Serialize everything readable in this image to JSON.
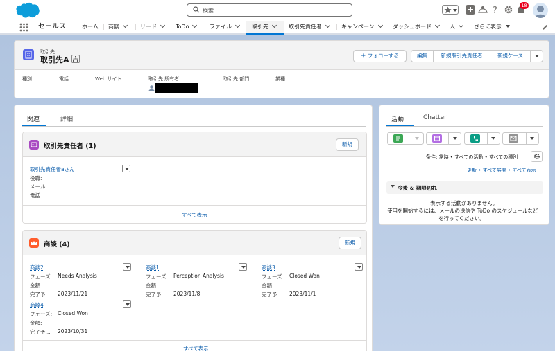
{
  "header": {
    "search_placeholder": "検索...",
    "notification_count": "18"
  },
  "nav": {
    "app_name": "セールス",
    "items": [
      {
        "label": "ホーム"
      },
      {
        "label": "商談"
      },
      {
        "label": "リード"
      },
      {
        "label": "ToDo"
      },
      {
        "label": "ファイル"
      },
      {
        "label": "取引先"
      },
      {
        "label": "取引先責任者"
      },
      {
        "label": "キャンペーン"
      },
      {
        "label": "ダッシュボード"
      },
      {
        "label": "人"
      },
      {
        "label": "さらに表示"
      }
    ]
  },
  "record": {
    "object_label": "取引先",
    "name": "取引先A",
    "actions": {
      "follow": "＋ フォローする",
      "edit": "編集",
      "new_contact": "新規取引先責任者",
      "new_case": "新規ケース"
    },
    "fields": [
      "種別",
      "電話",
      "Web サイト",
      "取引先 所有者",
      "取引先 部門",
      "業種"
    ]
  },
  "tabs": {
    "related": "関連",
    "detail": "詳細"
  },
  "contacts_card": {
    "title": "取引先責任者 (1)",
    "new_button": "新規",
    "contact_name": "取引先責任者aさん",
    "label_title": "役職:",
    "label_email": "メール:",
    "label_phone": "電話:",
    "view_all": "すべて表示"
  },
  "opps_card": {
    "title": "商談 (4)",
    "new_button": "新規",
    "phase_label": "フェーズ:",
    "amount_label": "金額:",
    "close_label": "完了予...",
    "items": [
      {
        "name": "商談2",
        "phase": "Needs Analysis",
        "close": "2023/11/21"
      },
      {
        "name": "商談1",
        "phase": "Perception Analysis",
        "close": "2023/11/8"
      },
      {
        "name": "商談3",
        "phase": "Closed Won",
        "close": "2023/11/1"
      },
      {
        "name": "商談4",
        "phase": "Closed Won",
        "close": "2023/10/31"
      }
    ],
    "view_all": "すべて表示"
  },
  "activity": {
    "tab_activity": "活動",
    "tab_chatter": "Chatter",
    "filter_text": "条件: 常時 • すべての活動 • すべての種別",
    "links": {
      "refresh": "更新",
      "sep1": " • ",
      "expand_all": "すべて展開",
      "sep2": " • ",
      "show_all": "すべて表示"
    },
    "section_title": "今後 & 期限切れ",
    "empty_line1": "表示する活動がありません。",
    "empty_line2": "使用を開始するには、メールの送信や ToDo のスケジュールなど",
    "empty_line3": "を行ってください。"
  },
  "colors": {
    "brand": "#0176d3",
    "account_icon": "#5867e8",
    "contact_icon": "#a94ac2",
    "opp_icon": "#ff5d2d",
    "task_icon": "#3ba755",
    "event_icon": "#b36ee3",
    "call_icon": "#0a9d85",
    "email_icon": "#939393"
  }
}
